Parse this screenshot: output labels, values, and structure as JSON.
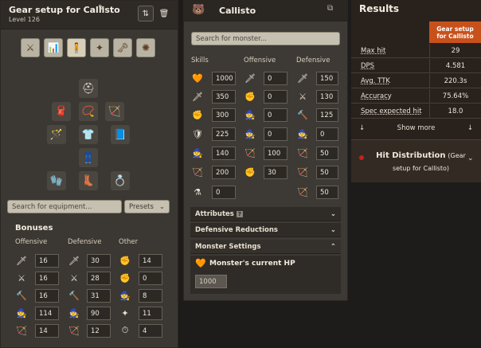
{
  "gear": {
    "title": "Gear setup for Callisto",
    "level": "Level 126",
    "search_placeholder": "Search for equipment...",
    "presets_label": "Presets",
    "bonuses_title": "Bonuses",
    "col_offensive": "Offensive",
    "col_defensive": "Defensive",
    "col_other": "Other",
    "offensive": [
      "16",
      "16",
      "16",
      "114",
      "14"
    ],
    "defensive": [
      "30",
      "28",
      "31",
      "90",
      "12"
    ],
    "other": [
      "14",
      "0",
      "8",
      "11",
      "4"
    ]
  },
  "monster": {
    "name": "Callisto",
    "search_placeholder": "Search for monster...",
    "col_skills": "Skills",
    "col_offensive": "Offensive",
    "col_defensive": "Defensive",
    "skills": [
      "1000",
      "350",
      "300",
      "225",
      "140",
      "200",
      "0"
    ],
    "offensive": [
      "0",
      "0",
      "0",
      "0",
      "100",
      "30"
    ],
    "defensive": [
      "150",
      "130",
      "125",
      "0",
      "50",
      "50",
      "50"
    ],
    "acc_attributes": "Attributes",
    "acc_defred": "Defensive Reductions",
    "acc_settings": "Monster Settings",
    "hp_label": "Monster's current HP",
    "hp_value": "1000"
  },
  "results": {
    "title": "Results",
    "column_header": "Gear setup for Callisto",
    "rows": [
      {
        "k": "Max hit",
        "v": "29"
      },
      {
        "k": "DPS",
        "v": "4.581"
      },
      {
        "k": "Avg. TTK",
        "v": "220.3s"
      },
      {
        "k": "Accuracy",
        "v": "75.64%"
      },
      {
        "k": "Spec expected hit",
        "v": "18.0"
      }
    ],
    "show_more": "Show more",
    "hit_dist": "Hit Distribution",
    "hit_dist_sub": "(Gear setup for Callisto)"
  },
  "colors": {
    "accent": "#c8511b",
    "panel": "#3d3934"
  }
}
